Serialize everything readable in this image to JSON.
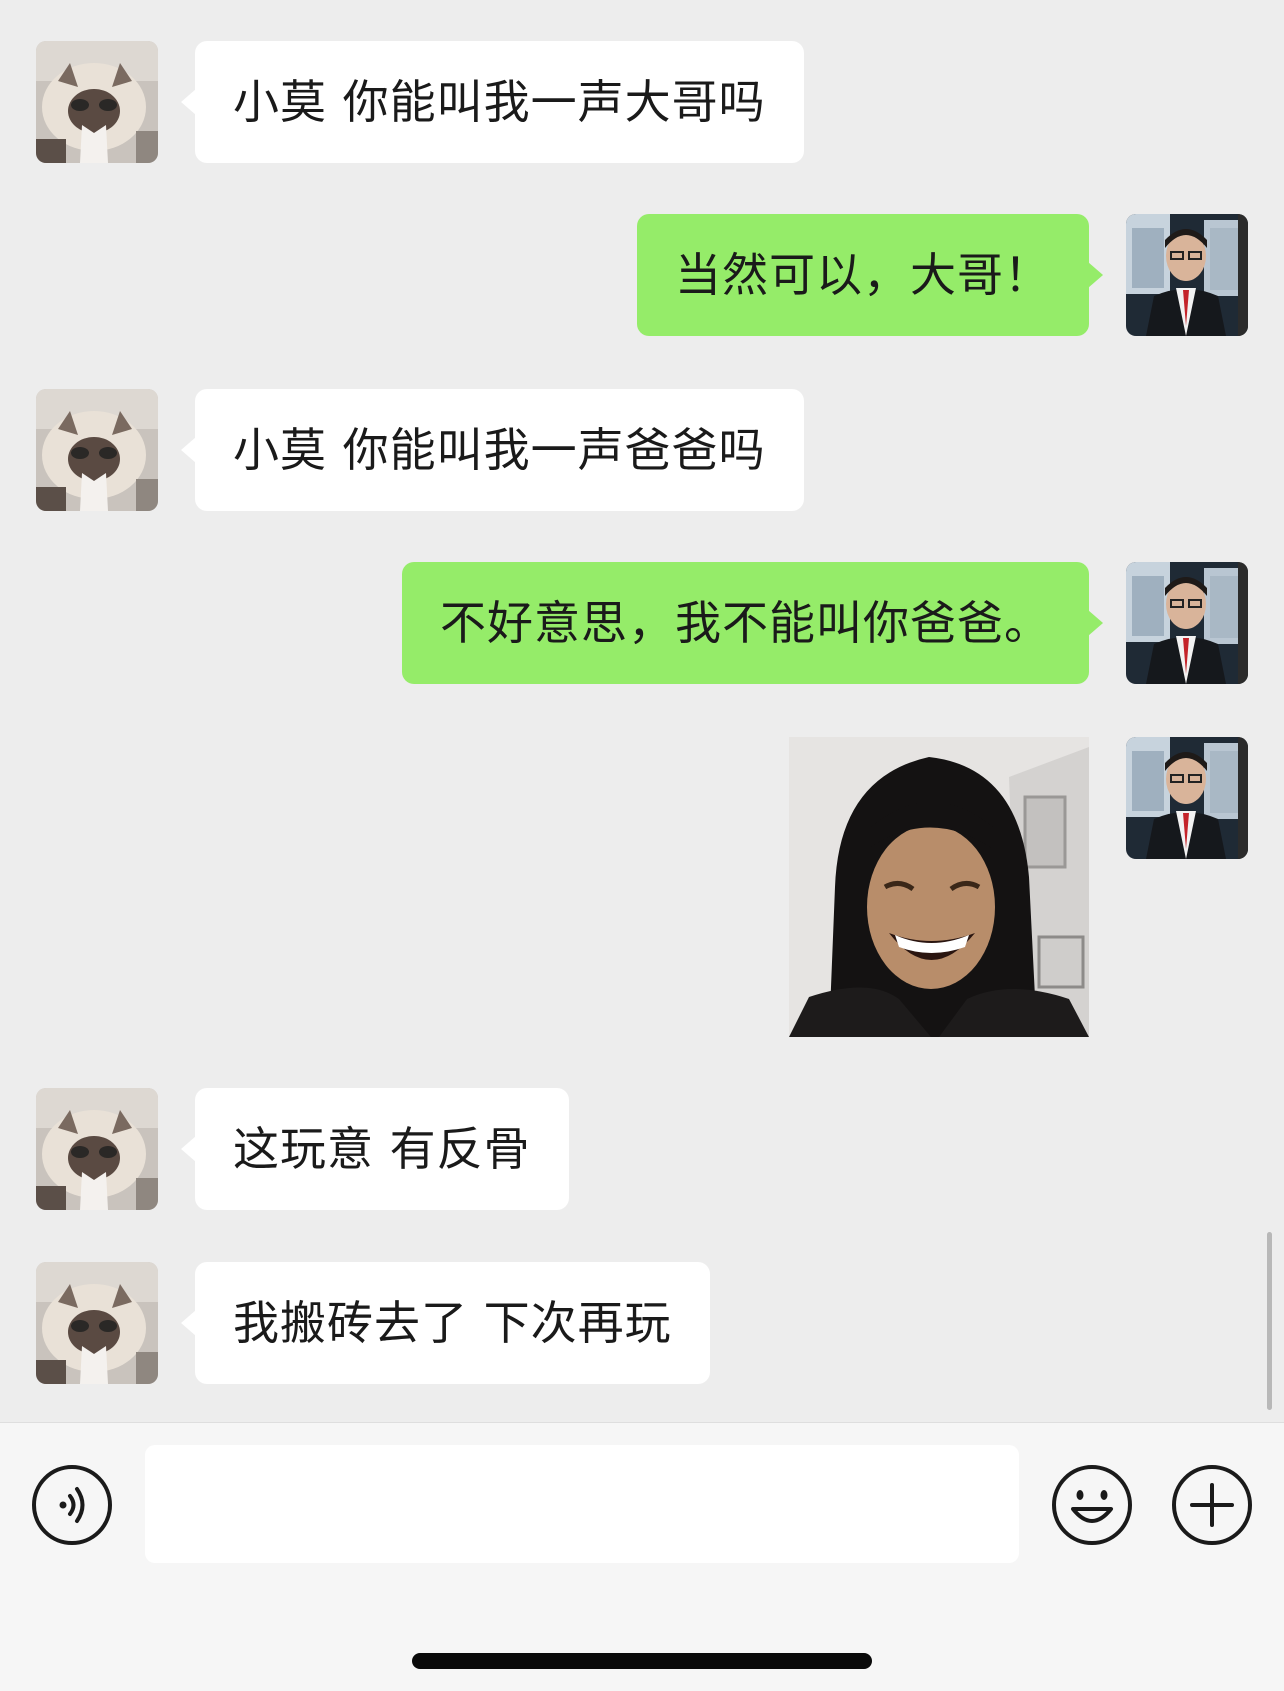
{
  "messages": [
    {
      "side": "in",
      "text": "小莫 你能叫我一声大哥吗"
    },
    {
      "side": "out",
      "text": "当然可以，大哥！"
    },
    {
      "side": "in",
      "text": "小莫 你能叫我一声爸爸吗"
    },
    {
      "side": "out",
      "text": "不好意思，我不能叫你爸爸。"
    },
    {
      "side": "out",
      "type": "sticker",
      "description": "laughing-man-sticker"
    },
    {
      "side": "in",
      "text": "这玩意 有反骨"
    },
    {
      "side": "in",
      "text": "我搬砖去了 下次再玩"
    }
  ],
  "input": {
    "value": "",
    "voice_icon": "voice-icon",
    "emoji_icon": "emoji-icon",
    "plus_icon": "plus-icon"
  },
  "colors": {
    "background": "#ededed",
    "incoming_bubble": "#ffffff",
    "outgoing_bubble": "#95ec69",
    "input_bar": "#f6f6f6"
  }
}
